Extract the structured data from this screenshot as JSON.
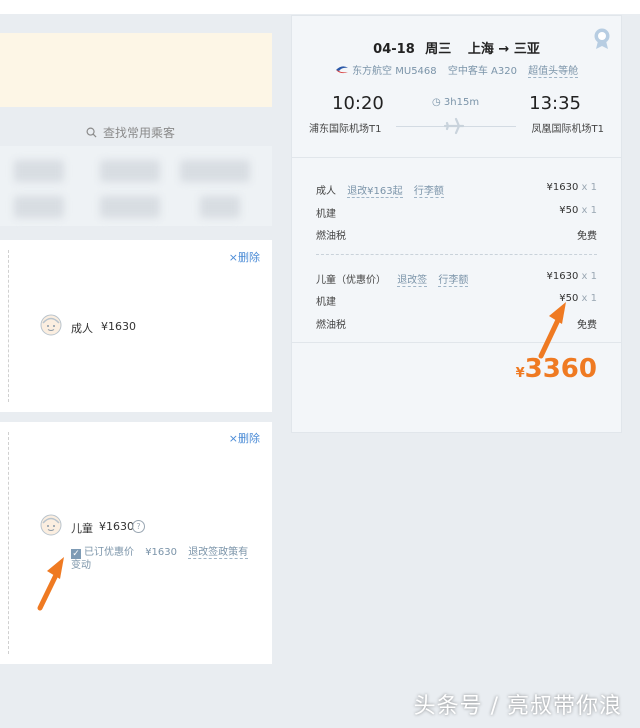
{
  "search": {
    "label": "查找常用乘客"
  },
  "passengers": [
    {
      "delete_label": "删除",
      "type_label": "成人",
      "price": "¥1630"
    },
    {
      "delete_label": "删除",
      "type_label": "儿童",
      "price": "¥1630",
      "help_icon": "question-icon",
      "discount_checked": true,
      "discount_label": "已订优惠价",
      "discount_price": "¥1630",
      "policy_text": "退改签政策有",
      "policy_tail": "变动"
    }
  ],
  "flight": {
    "date": "04-18",
    "weekday": "周三",
    "from_city": "上海",
    "to_city": "三亚",
    "airline": "东方航空 MU5468",
    "aircraft": "空中客车 A320",
    "cabin": "超值头等舱",
    "dep_time": "10:20",
    "arr_time": "13:35",
    "duration": "3h15m",
    "dep_airport": "浦东国际机场T1",
    "arr_airport": "凤凰国际机场T1"
  },
  "fares": {
    "adult": {
      "label": "成人",
      "tag1": "退改¥163起",
      "tag2": "行李额",
      "amount": "¥1630",
      "mult": "x 1"
    },
    "adult_tax": {
      "label": "机建",
      "amount": "¥50",
      "mult": "x 1"
    },
    "adult_fuel": {
      "label": "燃油税",
      "amount": "免费"
    },
    "child": {
      "label": "儿童（优惠价）",
      "tag1": "退改签",
      "tag2": "行李额",
      "amount": "¥1630",
      "mult": "x 1"
    },
    "child_tax": {
      "label": "机建",
      "amount": "¥50",
      "mult": "x 1"
    },
    "child_fuel": {
      "label": "燃油税",
      "amount": "免费"
    }
  },
  "total": {
    "currency": "¥",
    "amount": "3360"
  },
  "watermark": "头条号 / 亮叔带你浪",
  "colors": {
    "accent_orange": "#ef7a22",
    "link_blue": "#4a8bd6",
    "muted_blue": "#7b94a9"
  }
}
